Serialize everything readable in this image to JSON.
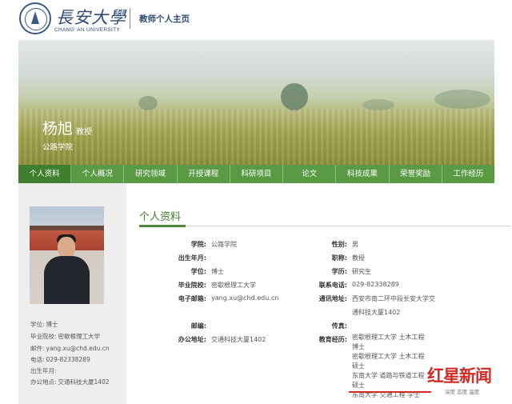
{
  "header": {
    "logo_cn": "長安大學",
    "logo_en": "CHANG' AN UNIVERSITY",
    "title": "教师个人主页"
  },
  "banner": {
    "name": "杨旭",
    "title": "教授",
    "school": "公路学院"
  },
  "nav": {
    "tabs": [
      {
        "label": "个人资料",
        "active": true
      },
      {
        "label": "个人概况"
      },
      {
        "label": "研究领域"
      },
      {
        "label": "开授课程"
      },
      {
        "label": "科研项目"
      },
      {
        "label": "论文"
      },
      {
        "label": "科技成果"
      },
      {
        "label": "荣誉奖励"
      },
      {
        "label": "工作经历"
      }
    ]
  },
  "sidebar": {
    "rows": [
      {
        "label": "学位:",
        "value": "博士"
      },
      {
        "label": "毕业院校:",
        "value": "密歇根理工大学"
      },
      {
        "label": "邮件:",
        "value": "yang.xu@chd.edu.cn"
      },
      {
        "label": "电话:",
        "value": "029-82338289"
      },
      {
        "label": "出生年月:",
        "value": ""
      },
      {
        "label": "办公地点:",
        "value": "交通科技大厦1402"
      }
    ]
  },
  "profile": {
    "section_title": "个人资料",
    "left": [
      {
        "label": "学院:",
        "value": "公路学院"
      },
      {
        "label": "出生年月:",
        "value": ""
      },
      {
        "label": "学位:",
        "value": "博士"
      },
      {
        "label": "毕业院校:",
        "value": "密歇根理工大学"
      },
      {
        "label": "电子邮箱:",
        "value": "yang.xu@chd.edu.cn"
      },
      {
        "label": "邮编:",
        "value": ""
      },
      {
        "label": "办公地址:",
        "value": "交通科技大厦1402"
      }
    ],
    "right": [
      {
        "label": "性别:",
        "value": "男"
      },
      {
        "label": "职称:",
        "value": "教授"
      },
      {
        "label": "学历:",
        "value": "研究生"
      },
      {
        "label": "联系电话:",
        "value": "029-82338289"
      },
      {
        "label": "通讯地址:",
        "value_lines": [
          "西安市南二环中段长安大学交",
          "通科技大厦1402"
        ]
      },
      {
        "label": "传真:",
        "value": ""
      },
      {
        "label": "教育经历:",
        "value_lines": [
          "密歇根理工大学 土木工程",
          "博士",
          "密歇根理工大学 土木工程",
          "硕士",
          "东南大学 道路与铁道工程",
          "硕士",
          "东南大学 交通工程 学士"
        ]
      }
    ]
  },
  "watermark": {
    "brand": "红星新闻",
    "slogan": "深度 态度 温度",
    "accent_color": "#d42a26"
  },
  "colors": {
    "nav_green": "#5a9a45",
    "nav_active": "#3f7f2e",
    "brand_blue": "#2f4a78"
  }
}
